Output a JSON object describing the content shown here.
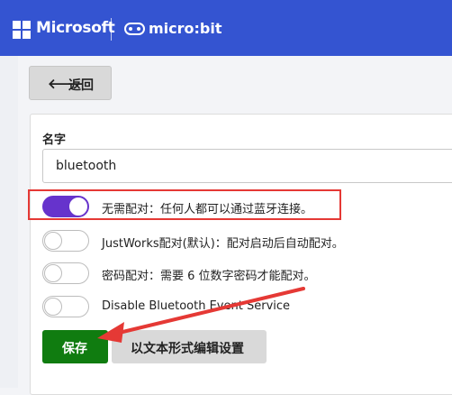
{
  "header": {
    "brand": "Microsoft",
    "product": "micro:bit",
    "brand_logo_icon": "microsoft-logo-icon",
    "product_logo_icon": "microbit-logo-icon"
  },
  "back_button": {
    "label": "返回",
    "icon": "arrow-left-icon"
  },
  "form": {
    "name_label": "名字",
    "name_value": "bluetooth"
  },
  "options": [
    {
      "label": "无需配对：任何人都可以通过蓝牙连接。",
      "enabled": true
    },
    {
      "label": "JustWorks配对(默认)：配对启动后自动配对。",
      "enabled": false
    },
    {
      "label": "密码配对：需要 6 位数字密码才能配对。",
      "enabled": false
    },
    {
      "label": "Disable Bluetooth Event Service",
      "enabled": false
    }
  ],
  "actions": {
    "save_label": "保存",
    "edit_as_text_label": "以文本形式编辑设置"
  },
  "colors": {
    "header_bg": "#3454d1",
    "toggle_on": "#6633cc",
    "save_bg": "#107c10",
    "highlight": "#e53935"
  }
}
